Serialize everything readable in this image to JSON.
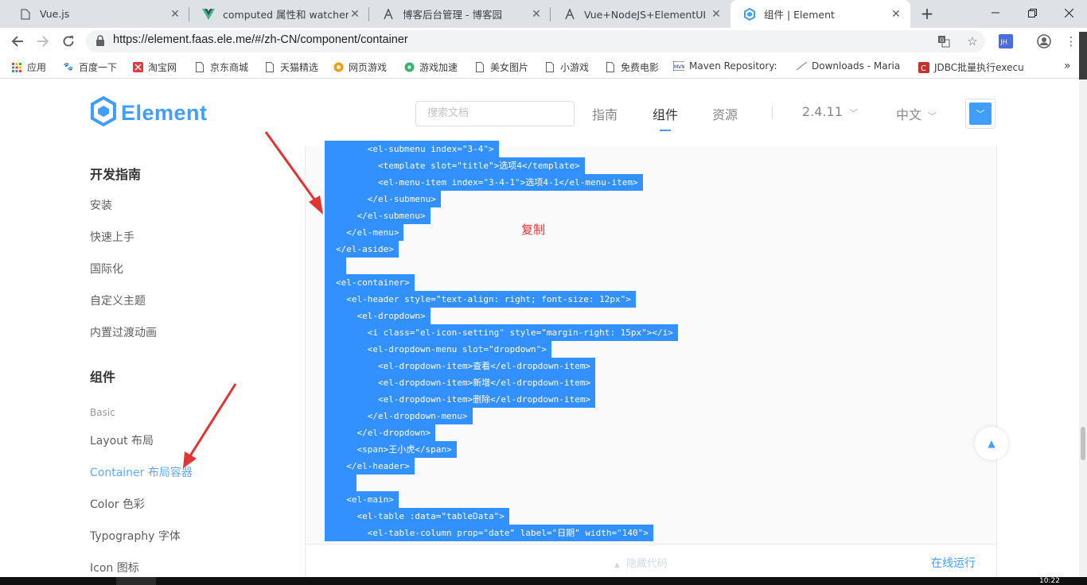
{
  "browser": {
    "tabs": [
      {
        "title": "Vue.js",
        "icon": "page-icon"
      },
      {
        "title": "computed 属性和 watcher - V",
        "icon": "vue-logo-icon"
      },
      {
        "title": "博客后台管理 - 博客园",
        "icon": "cnblogs-icon"
      },
      {
        "title": "Vue+NodeJS+ElementUI 的",
        "icon": "cnblogs-icon"
      },
      {
        "title": "组件 | Element",
        "icon": "element-logo-icon",
        "active": true
      }
    ],
    "url": "https://element.faas.ele.me/#/zh-CN/component/container",
    "bookmarks": [
      {
        "label": "应用",
        "icon": "apps-grid-icon"
      },
      {
        "label": "百度一下",
        "icon": "baidu-paw-icon"
      },
      {
        "label": "淘宝网",
        "icon": "taobao-icon"
      },
      {
        "label": "京东商城",
        "icon": "page-icon"
      },
      {
        "label": "天猫精选",
        "icon": "page-icon"
      },
      {
        "label": "网页游戏",
        "icon": "game-icon"
      },
      {
        "label": "游戏加速",
        "icon": "accelerator-icon"
      },
      {
        "label": "美女图片",
        "icon": "page-icon"
      },
      {
        "label": "小游戏",
        "icon": "page-icon"
      },
      {
        "label": "免费电影",
        "icon": "page-icon"
      },
      {
        "label": "Maven Repository:",
        "icon": "maven-icon"
      },
      {
        "label": "Downloads - Maria",
        "icon": "mariadb-icon"
      },
      {
        "label": "JDBC批量执行execu",
        "icon": "csdn-icon"
      }
    ],
    "more_bookmarks": "»"
  },
  "site": {
    "logo": "Element",
    "search_placeholder": "搜索文档",
    "nav": [
      "指南",
      "组件",
      "资源"
    ],
    "version": "2.4.11",
    "language": "中文"
  },
  "sidebar": {
    "group_dev": "开发指南",
    "dev_items": [
      "安装",
      "快速上手",
      "国际化",
      "自定义主题",
      "内置过渡动画"
    ],
    "group_components": "组件",
    "basic_label": "Basic",
    "component_items": [
      "Layout 布局",
      "Container 布局容器",
      "Color 色彩",
      "Typography 字体",
      "Icon 图标"
    ]
  },
  "code": {
    "lines": [
      "      <el-submenu index=\"3-4\">",
      "        <template slot=\"title\">选项4</template>",
      "        <el-menu-item index=\"3-4-1\">选项4-1</el-menu-item>",
      "      </el-submenu>",
      "    </el-submenu>",
      "  </el-menu>",
      "</el-aside>",
      " ",
      "<el-container>",
      "  <el-header style=\"text-align: right; font-size: 12px\">",
      "    <el-dropdown>",
      "      <i class=\"el-icon-setting\" style=\"margin-right: 15px\"></i>",
      "      <el-dropdown-menu slot=\"dropdown\">",
      "        <el-dropdown-item>查看</el-dropdown-item>",
      "        <el-dropdown-item>新增</el-dropdown-item>",
      "        <el-dropdown-item>删除</el-dropdown-item>",
      "      </el-dropdown-menu>",
      "    </el-dropdown>",
      "    <span>王小虎</span>",
      "  </el-header>",
      "   ",
      "  <el-main>",
      "    <el-table :data=\"tableData\">",
      "      <el-table-column prop=\"date\" label=\"日期\" width=\"140\">"
    ],
    "copy_annotation": "复制",
    "hide_code": "隐藏代码",
    "run_online": "在线运行"
  },
  "taskbar": {
    "clock": "10:22"
  },
  "colors": {
    "accent": "#409eff",
    "selection": "#3390ff",
    "annotation": "#e33333"
  }
}
